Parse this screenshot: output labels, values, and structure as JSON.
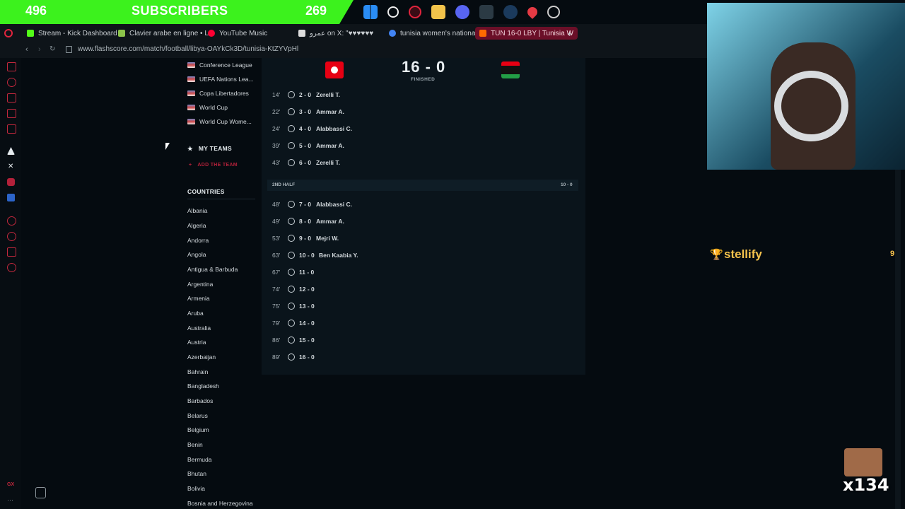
{
  "overlay": {
    "left_count": "496",
    "title": "SUBSCRIBERS",
    "right_count": "269",
    "bar_color": "#3cf21d"
  },
  "taskbar": {
    "icons": [
      "windows-start-icon",
      "search-icon",
      "opera-gx-icon",
      "file-explorer-icon",
      "discord-icon",
      "app-icon",
      "steam-icon",
      "maps-pin-icon",
      "settings-icon"
    ]
  },
  "browser": {
    "tabs": [
      {
        "label": "Stream - Kick Dashboard"
      },
      {
        "label": "Clavier arabe en ligne • L"
      },
      {
        "label": "YouTube Music"
      },
      {
        "label": "عمرو on X: \"♥♥♥♥♥♥"
      },
      {
        "label": "tunisia women's national"
      },
      {
        "label": "TUN 16-0 LBY | Tunisia W"
      }
    ],
    "url": "www.flashscore.com/match/football/libya-OAYkCk3D/tunisia-KtZYVpHl"
  },
  "sidebar": {
    "competitions": [
      "Conference League",
      "UEFA Nations Lea...",
      "Copa Libertadores",
      "World Cup",
      "World Cup Wome..."
    ],
    "my_teams": "MY TEAMS",
    "add_team": "ADD THE TEAM",
    "countries_title": "COUNTRIES",
    "countries": [
      "Albania",
      "Algeria",
      "Andorra",
      "Angola",
      "Antigua & Barbuda",
      "Argentina",
      "Armenia",
      "Aruba",
      "Australia",
      "Austria",
      "Azerbaijan",
      "Bahrain",
      "Bangladesh",
      "Barbados",
      "Belarus",
      "Belgium",
      "Benin",
      "Bermuda",
      "Bhutan",
      "Bolivia",
      "Bosnia and Herzegovina"
    ]
  },
  "match": {
    "score": "16 - 0",
    "status": "FINISHED",
    "first_half_events": [
      {
        "minute": "14'",
        "score": "2 - 0",
        "player": "Zerelli T."
      },
      {
        "minute": "22'",
        "score": "3 - 0",
        "player": "Ammar A."
      },
      {
        "minute": "24'",
        "score": "4 - 0",
        "player": "Alabbassi C."
      },
      {
        "minute": "39'",
        "score": "5 - 0",
        "player": "Ammar A."
      },
      {
        "minute": "43'",
        "score": "6 - 0",
        "player": "Zerelli T."
      }
    ],
    "second_half_label": "2ND HALF",
    "second_half_score": "10 - 0",
    "second_half_events": [
      {
        "minute": "48'",
        "score": "7 - 0",
        "player": "Alabbassi C."
      },
      {
        "minute": "49'",
        "score": "8 - 0",
        "player": "Ammar A."
      },
      {
        "minute": "53'",
        "score": "9 - 0",
        "player": "Mejri W."
      },
      {
        "minute": "63'",
        "score": "10 - 0",
        "player": "Ben Kaabia Y."
      },
      {
        "minute": "67'",
        "score": "11 - 0",
        "player": ""
      },
      {
        "minute": "74'",
        "score": "12 - 0",
        "player": ""
      },
      {
        "minute": "75'",
        "score": "13 - 0",
        "player": ""
      },
      {
        "minute": "79'",
        "score": "14 - 0",
        "player": ""
      },
      {
        "minute": "86'",
        "score": "15 - 0",
        "player": ""
      },
      {
        "minute": "89'",
        "score": "16 - 0",
        "player": ""
      }
    ]
  },
  "chat": {
    "name": "stellify",
    "count": "9",
    "color": "#f5c24c"
  },
  "emote": {
    "multiplier": "x134"
  }
}
